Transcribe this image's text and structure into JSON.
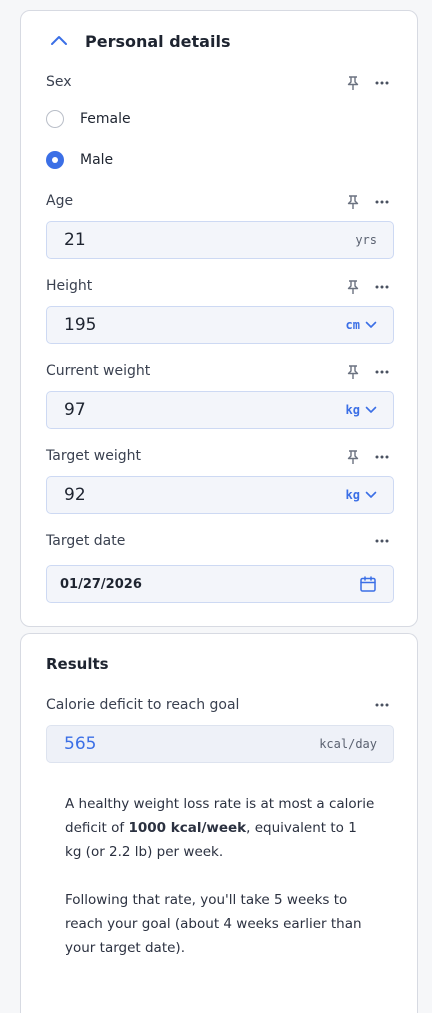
{
  "personal": {
    "title": "Personal details",
    "sex": {
      "label": "Sex",
      "options": [
        "Female",
        "Male"
      ],
      "selected": "Male"
    },
    "age": {
      "label": "Age",
      "value": "21",
      "unit": "yrs"
    },
    "height": {
      "label": "Height",
      "value": "195",
      "unit": "cm"
    },
    "current_weight": {
      "label": "Current weight",
      "value": "97",
      "unit": "kg"
    },
    "target_weight": {
      "label": "Target weight",
      "value": "92",
      "unit": "kg"
    },
    "target_date": {
      "label": "Target date",
      "value": "01/27/2026"
    }
  },
  "results": {
    "title": "Results",
    "deficit": {
      "label": "Calorie deficit to reach goal",
      "value": "565",
      "unit": "kcal/day"
    },
    "para1_pre": "A healthy weight loss rate is at most a calorie deficit of ",
    "para1_bold": "1000 kcal/week",
    "para1_post": ", equivalent to 1 kg (or 2.2 lb) per week.",
    "para2": "Following that rate, you'll take 5 weeks to reach your goal (about 4 weeks earlier than your target date)."
  },
  "colors": {
    "accent": "#3b6fe6",
    "border": "#cdd9f3",
    "field_bg": "#f3f5fa"
  }
}
